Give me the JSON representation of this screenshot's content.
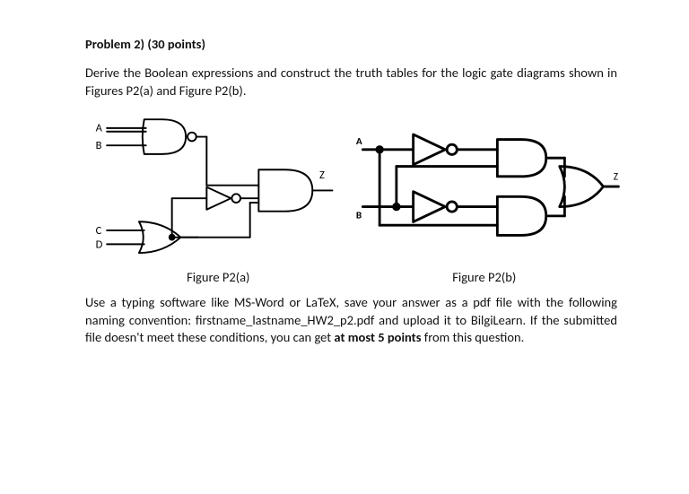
{
  "heading": "Problem 2) (30 points)",
  "prompt": "Derive the Boolean expressions and construct the truth tables for the logic gate diagrams shown in Figures P2(a) and Figure P2(b).",
  "figA": {
    "caption": "Figure P2(a)",
    "labels": {
      "A": "A",
      "B": "B",
      "C": "C",
      "D": "D",
      "Z": "Z"
    }
  },
  "figB": {
    "caption": "Figure P2(b)",
    "labels": {
      "A": "A",
      "B": "B",
      "Z": "Z"
    }
  },
  "instructions_pre": "Use a typing software like MS-Word or LaTeX, save your answer as a pdf file with the following naming convention: firstname_lastname_HW2_p2.pdf and upload it to BilgiLearn. If the submitted file doesn't meet these conditions, you can get ",
  "instructions_bold": "at most 5 points",
  "instructions_post": " from this question."
}
